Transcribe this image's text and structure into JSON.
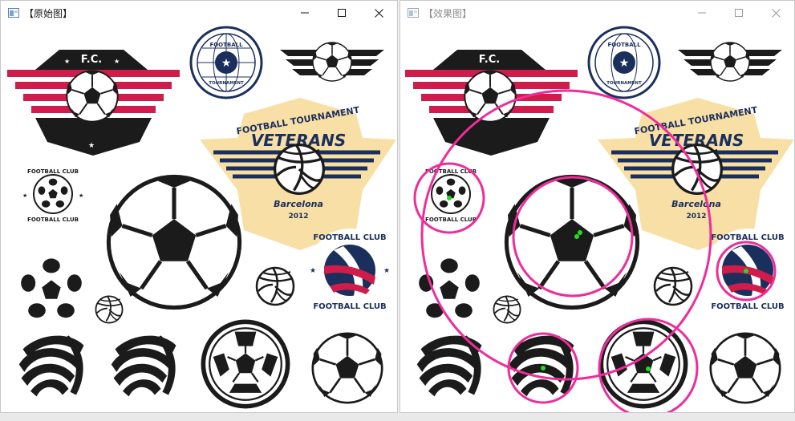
{
  "windows": {
    "left": {
      "title": "【原始图】"
    },
    "right": {
      "title": "【效果图】"
    }
  },
  "logos": {
    "fc_text": "F.C.",
    "football_text": "FOOTBALL",
    "tournament_text": "TOURNAMENT",
    "top_ring_text": "FOOTBALL TOURNAMENT",
    "veterans_heading": "FOOTBALL TOURNAMENT",
    "veterans_name": "VETERANS",
    "veterans_city": "Barcelona",
    "veterans_year": "2012",
    "club_badge_top": "FOOTBALL CLUB",
    "club_badge_bottom": "FOOTBALL CLUB",
    "small_club_top": "FOOTBALL CLUB",
    "small_club_bottom": "FOOTBALL CLUB"
  },
  "colors": {
    "red": "#d01c4b",
    "navy": "#1b2f5c",
    "cream": "#f8dfa5",
    "ink": "#1b1b1b",
    "magenta": "#ee2d9a",
    "green": "#22dd22"
  }
}
